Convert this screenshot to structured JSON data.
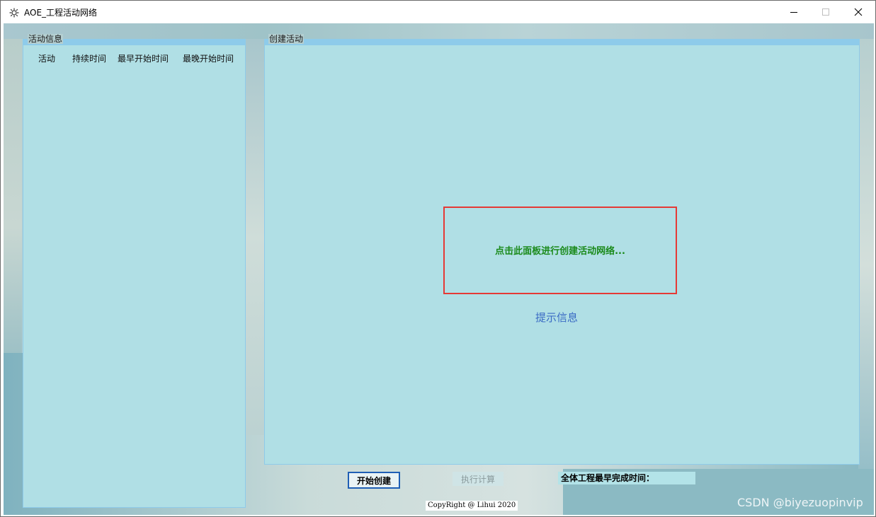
{
  "window": {
    "title": "AOE_工程活动网络",
    "app_icon": "gear-icon",
    "controls": {
      "minimize": "minimize-icon",
      "maximize": "maximize-icon",
      "close": "close-icon"
    }
  },
  "left_panel": {
    "title": "活动信息",
    "columns": [
      "活动",
      "持续时间",
      "最早开始时间",
      "最晚开始时间"
    ],
    "rows": []
  },
  "right_panel": {
    "title": "创建活动",
    "hint": "点击此面板进行创建活动网络...",
    "info_label": "提示信息"
  },
  "bottom": {
    "start_button": "开始创建",
    "exec_button": "执行计算",
    "finish_label": "全体工程最早完成时间：",
    "copyright": "CopyRight @ Lihui 2020"
  },
  "watermark": "CSDN @biyezuopinvip",
  "colors": {
    "panel_bg": "#b0dfe5",
    "panel_border": "#8ecbea",
    "hint_border": "#e53935",
    "hint_text": "#1a8a1a",
    "info_text": "#3a6bc4",
    "start_button_border": "#1f5fb5"
  }
}
